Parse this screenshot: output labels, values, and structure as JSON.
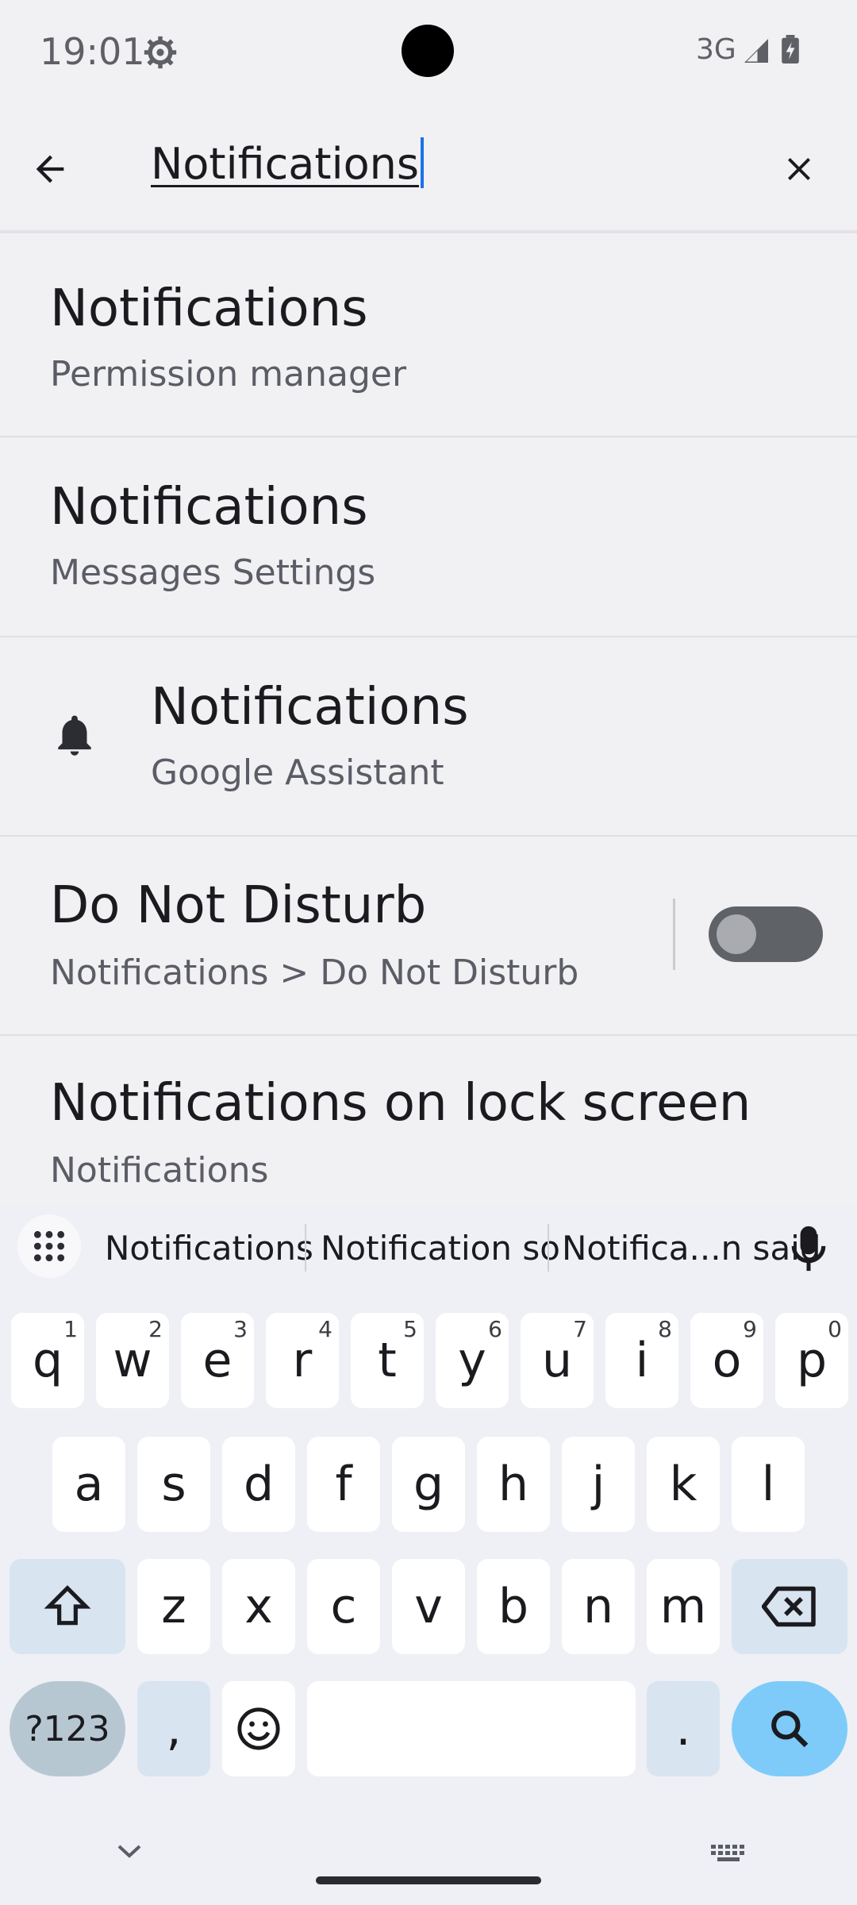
{
  "status_bar": {
    "time": "19:01",
    "network": "3G",
    "icons": [
      "gear-icon",
      "signal-icon",
      "battery-icon"
    ]
  },
  "search": {
    "query": "Notifications",
    "back_icon": "arrow-back-icon",
    "clear_icon": "close-icon"
  },
  "results": [
    {
      "title": "Notifications",
      "subtitle": "Permission manager"
    },
    {
      "title": "Notifications",
      "subtitle": "Messages Settings"
    },
    {
      "title": "Notifications",
      "subtitle": "Google Assistant",
      "icon": "bell-icon"
    },
    {
      "title": "Do Not Disturb",
      "subtitle": "Notifications > Do Not Disturb",
      "toggle": "off"
    },
    {
      "title": "Notifications on lock screen",
      "subtitle": "Notifications"
    }
  ],
  "keyboard": {
    "suggestions": [
      "Notifications",
      "Notification so",
      "Notifica...n said"
    ],
    "row1": [
      "q",
      "w",
      "e",
      "r",
      "t",
      "y",
      "u",
      "i",
      "o",
      "p"
    ],
    "row1_nums": [
      "1",
      "2",
      "3",
      "4",
      "5",
      "6",
      "7",
      "8",
      "9",
      "0"
    ],
    "row2": [
      "a",
      "s",
      "d",
      "f",
      "g",
      "h",
      "j",
      "k",
      "l"
    ],
    "row3": [
      "z",
      "x",
      "c",
      "v",
      "b",
      "n",
      "m"
    ],
    "numbers_key": "?123",
    "comma_key": ",",
    "period_key": ".",
    "accent_color": "#7ecbfa"
  }
}
